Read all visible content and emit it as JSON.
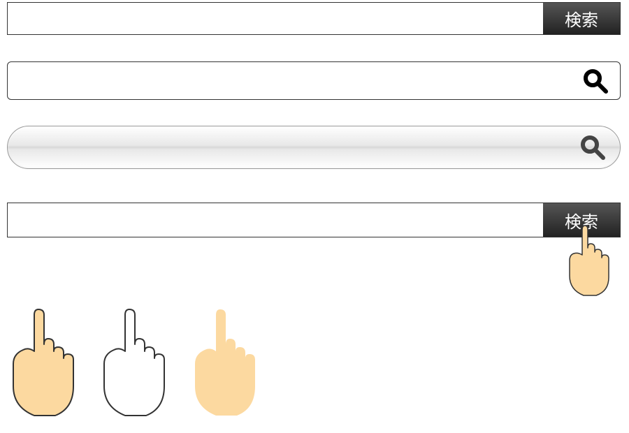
{
  "search_bars": {
    "bar1": {
      "value": "",
      "placeholder": "",
      "button_label": "検索"
    },
    "bar2": {
      "value": "",
      "placeholder": ""
    },
    "bar3": {
      "value": "",
      "placeholder": ""
    },
    "bar4": {
      "value": "",
      "placeholder": "",
      "button_label": "検索"
    }
  },
  "colors": {
    "button_dark": "#333333",
    "hand_fill": "#fcd9a0",
    "hand_outline": "#333333"
  }
}
